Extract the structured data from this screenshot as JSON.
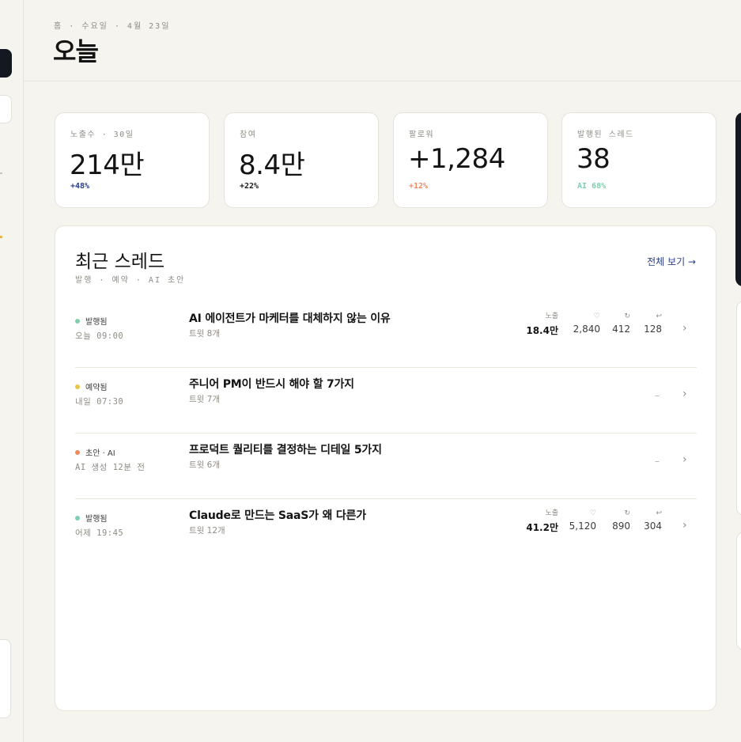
{
  "header": {
    "breadcrumb": "홈 · 수요일 · 4월 23일",
    "title": "오늘"
  },
  "stats": [
    {
      "label": "노출수 · 30일",
      "value": "214만",
      "delta": "+48%",
      "delta_color": "#2a3f8a"
    },
    {
      "label": "참여",
      "value": "8.4만",
      "delta": "+22%",
      "delta_color": "#1a1a1a"
    },
    {
      "label": "팔로워",
      "value": "+1,284",
      "delta": "+12%",
      "delta_color": "#f08a66"
    },
    {
      "label": "발행된 스레드",
      "value": "38",
      "delta": "AI 68%",
      "delta_color": "#7fcfae"
    }
  ],
  "threads": {
    "title": "최근 스레드",
    "subtitle": "발행 · 예약 · AI 초안",
    "view_all": "전체 보기 →",
    "metric_labels": {
      "impressions": "노출",
      "likes_icon": "heart-icon",
      "reposts_icon": "repost-icon",
      "replies_icon": "reply-icon"
    },
    "rows": [
      {
        "status": "발행됨",
        "status_color": "#7fcfae",
        "when": "오늘 09:00",
        "title": "AI 에이전트가 마케터를 대체하지 않는 이유",
        "count": "트윗 8개",
        "impressions": "18.4만",
        "likes": "2,840",
        "reposts": "412",
        "replies": "128"
      },
      {
        "status": "예약됨",
        "status_color": "#e9c547",
        "when": "내일 07:30",
        "title": "주니어 PM이 반드시 해야 할 7가지",
        "count": "트윗 7개",
        "dash": "–"
      },
      {
        "status": "초안 · AI",
        "status_color": "#ef8a5a",
        "when": "AI 생성 12분 전",
        "title": "프로덕트 퀄리티를 결정하는 디테일 5가지",
        "count": "트윗 6개",
        "dash": "–"
      },
      {
        "status": "발행됨",
        "status_color": "#7fcfae",
        "when": "어제 19:45",
        "title": "Claude로 만드는 SaaS가 왜 다른가",
        "count": "트윗 12개",
        "impressions": "41.2만",
        "likes": "5,120",
        "reposts": "890",
        "replies": "304"
      }
    ]
  }
}
